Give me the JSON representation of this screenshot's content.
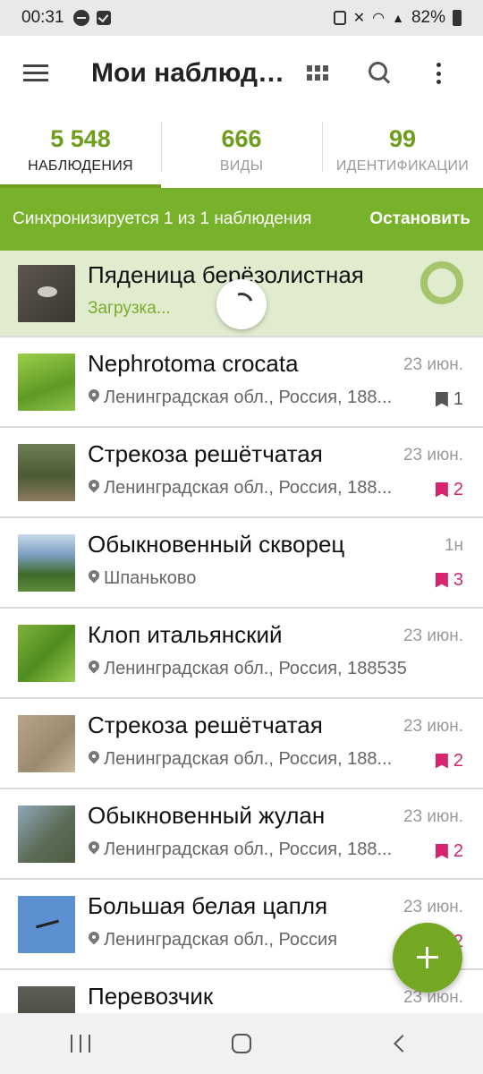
{
  "status_bar": {
    "time": "00:31",
    "battery": "82%"
  },
  "app_bar": {
    "title": "Мои наблюде..."
  },
  "stats": [
    {
      "value": "5 548",
      "label": "НАБЛЮДЕНИЯ"
    },
    {
      "value": "666",
      "label": "ВИДЫ"
    },
    {
      "value": "99",
      "label": "ИДЕНТИФИКАЦИИ"
    }
  ],
  "sync_banner": {
    "text": "Синхронизируется 1 из 1 наблюдения",
    "stop_label": "Остановить"
  },
  "uploading": {
    "name": "Пяденица берёзолистная",
    "status": "Загрузка..."
  },
  "observations": [
    {
      "name": "Nephrotoma crocata",
      "date": "23 июн.",
      "place": "Ленинградская обл., Россия, 188...",
      "ids": "1",
      "id_color": "#555555"
    },
    {
      "name": "Стрекоза решётчатая",
      "date": "23 июн.",
      "place": "Ленинградская обл., Россия, 188...",
      "ids": "2",
      "id_color": "#d6246e"
    },
    {
      "name": "Обыкновенный скворец",
      "date": "1н",
      "place": "Шпаньково",
      "ids": "3",
      "id_color": "#d6246e"
    },
    {
      "name": "Клоп итальянский",
      "date": "23 июн.",
      "place": "Ленинградская обл., Россия, 188535",
      "ids": "",
      "id_color": ""
    },
    {
      "name": "Стрекоза решётчатая",
      "date": "23 июн.",
      "place": "Ленинградская обл., Россия, 188...",
      "ids": "2",
      "id_color": "#d6246e"
    },
    {
      "name": "Обыкновенный жулан",
      "date": "23 июн.",
      "place": "Ленинградская обл., Россия, 188...",
      "ids": "2",
      "id_color": "#d6246e"
    },
    {
      "name": "Большая белая цапля",
      "date": "23 июн.",
      "place": "Ленинградская обл., Россия",
      "ids": "2",
      "id_color": "#d6246e"
    },
    {
      "name": "Перевозчик",
      "date": "23 июн.",
      "place": "",
      "ids": "",
      "id_color": ""
    }
  ],
  "icons": {
    "menu": "hamburger-icon",
    "grid": "grid-view-icon",
    "search": "search-icon",
    "more": "more-vert-icon",
    "pin": "location-pin-icon",
    "ids": "identification-tag-icon",
    "add": "plus-icon"
  },
  "colors": {
    "accent": "#74a823",
    "sync_banner": "#78b12a",
    "uploading_row": "#e1eccf",
    "id_badge": "#d6246e"
  }
}
